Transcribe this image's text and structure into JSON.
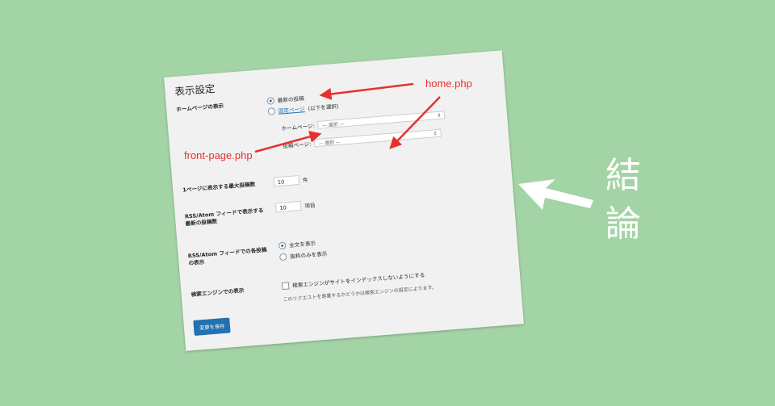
{
  "settings": {
    "title": "表示設定",
    "homepage": {
      "label": "ホームページの表示",
      "option_latest": "最新の投稿",
      "option_static_link": "固定ページ",
      "option_static_suffix": "(以下を選択)",
      "homepage_select_label": "ホームページ:",
      "homepage_select_value": "— 選択 —",
      "posts_select_label": "投稿ページ:",
      "posts_select_value": "— 選択 —"
    },
    "per_page": {
      "label": "1ページに表示する最大投稿数",
      "value": "10",
      "unit": "件"
    },
    "rss_count": {
      "label_line1": "RSS/Atom フィードで表示する",
      "label_line2": "最新の投稿数",
      "value": "10",
      "unit": "項目"
    },
    "rss_mode": {
      "label_line1": "RSS/Atom フィードでの各投稿",
      "label_line2": "の表示",
      "option_full": "全文を表示",
      "option_excerpt": "抜粋のみを表示"
    },
    "search_engine": {
      "label": "検索エンジンでの表示",
      "checkbox_label": "検索エンジンがサイトをインデックスしないようにする",
      "description": "このリクエストを尊重するかどうかは検索エンジンの設定によります。"
    },
    "save_label": "変更を保存"
  },
  "annotations": {
    "home_php": "home.php",
    "front_page_php": "front-page.php",
    "conclusion_char1": "結",
    "conclusion_char2": "論",
    "arrow_color": "#e8302a"
  },
  "colors": {
    "background": "#a3d4a5",
    "panel": "#f1f1f1",
    "accent": "#2271b1"
  }
}
